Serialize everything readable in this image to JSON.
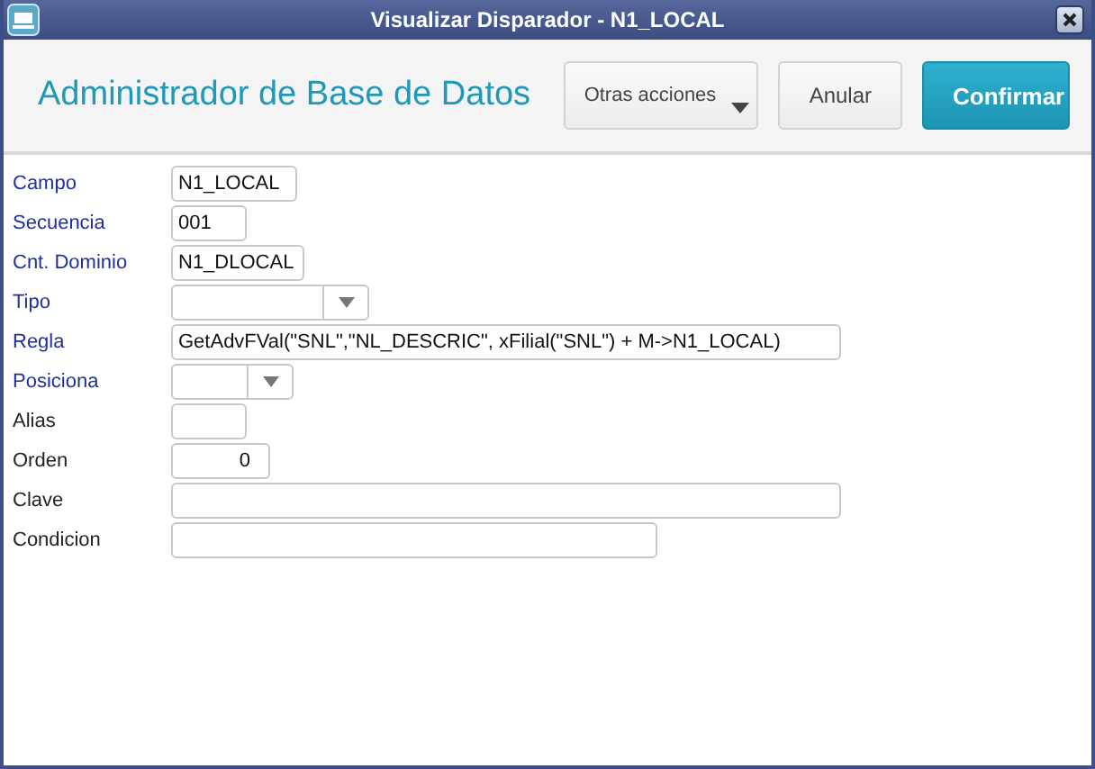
{
  "window": {
    "title": "Visualizar Disparador - N1_LOCAL"
  },
  "header": {
    "title": "Administrador de Base de Datos",
    "buttons": [
      {
        "label": "Otras acciones",
        "kind": "menu"
      },
      {
        "label": "Anular",
        "kind": "secondary"
      },
      {
        "label": "Confirmar",
        "kind": "primary"
      }
    ]
  },
  "fields": [
    {
      "label": "Campo",
      "required": true,
      "kind": "text",
      "value": "N1_LOCAL"
    },
    {
      "label": "Secuencia",
      "required": true,
      "kind": "text",
      "value": "001"
    },
    {
      "label": "Cnt. Dominio",
      "required": true,
      "kind": "text",
      "value": "N1_DLOCAL"
    },
    {
      "label": "Tipo",
      "required": true,
      "kind": "select"
    },
    {
      "label": "Regla",
      "required": true,
      "kind": "text",
      "value": "GetAdvFVal(\"SNL\",\"NL_DESCRIC\", xFilial(\"SNL\") + M->N1_LOCAL)"
    },
    {
      "label": "Posiciona",
      "required": true,
      "kind": "select"
    },
    {
      "label": "Alias",
      "required": false,
      "kind": "text"
    },
    {
      "label": "Orden",
      "required": false,
      "kind": "number",
      "value": "0"
    },
    {
      "label": "Clave",
      "required": false,
      "kind": "text"
    },
    {
      "label": "Condicion",
      "required": false,
      "kind": "text"
    }
  ]
}
